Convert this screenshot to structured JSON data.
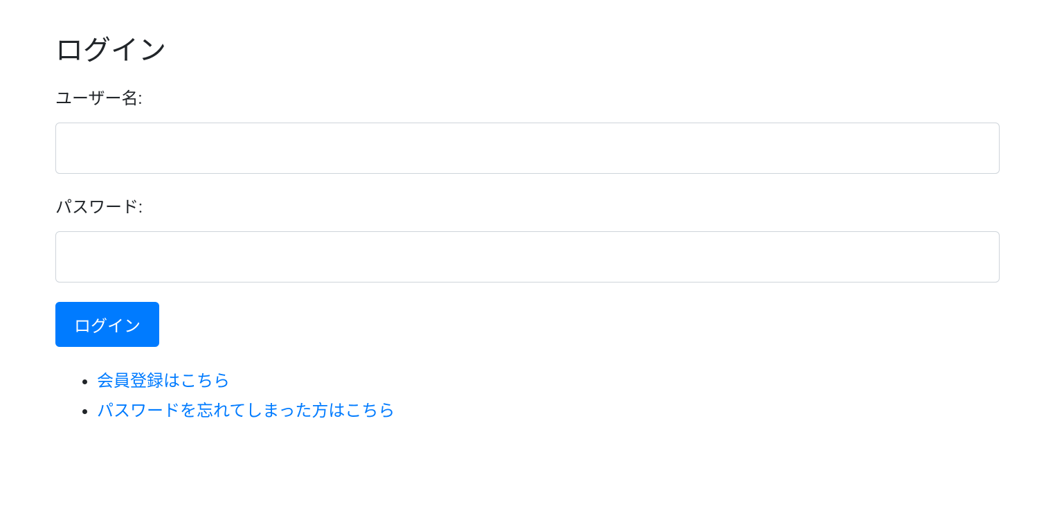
{
  "header": {
    "title": "ログイン"
  },
  "form": {
    "username_label": "ユーザー名:",
    "username_value": "",
    "password_label": "パスワード:",
    "password_value": "",
    "submit_label": "ログイン"
  },
  "links": {
    "register": "会員登録はこちら",
    "forgot_password": "パスワードを忘れてしまった方はこちら"
  }
}
